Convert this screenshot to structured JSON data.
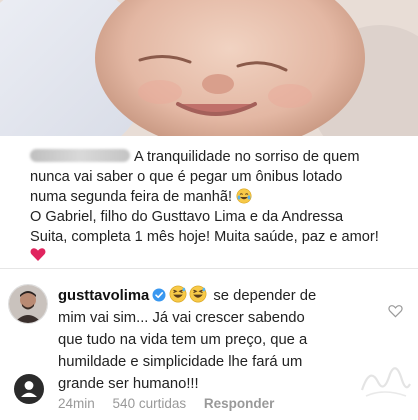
{
  "post": {
    "caption_line1": "A tranquilidade no sorriso de quem",
    "caption_line2": "nunca vai saber o que é pegar um ônibus lotado",
    "caption_line3": "numa segunda feira de manhã!",
    "caption_line4": "O Gabriel, filho do Gusttavo Lima e da Andressa",
    "caption_line5": "Suita, completa 1 mês hoje! Muita saúde, paz e amor!",
    "emoji_name": "tears-of-joy-icon",
    "heart_color": "#e0245e"
  },
  "comment": {
    "username": "gusttavolima",
    "text_line1": "se depender de",
    "text_line2": "mim vai sim... Já vai crescer sabendo",
    "text_line3": "que tudo na vida tem um preço, que a",
    "text_line4": "humildade e simplicidade lhe fará um",
    "text_line5": "grande ser humano!!!",
    "verified_color": "#3897f0"
  },
  "meta": {
    "time": "24min",
    "likes": "540 curtidas",
    "reply": "Responder"
  },
  "colors": {
    "emoji_yellow": "#f7c948",
    "meta_gray": "#999999"
  }
}
